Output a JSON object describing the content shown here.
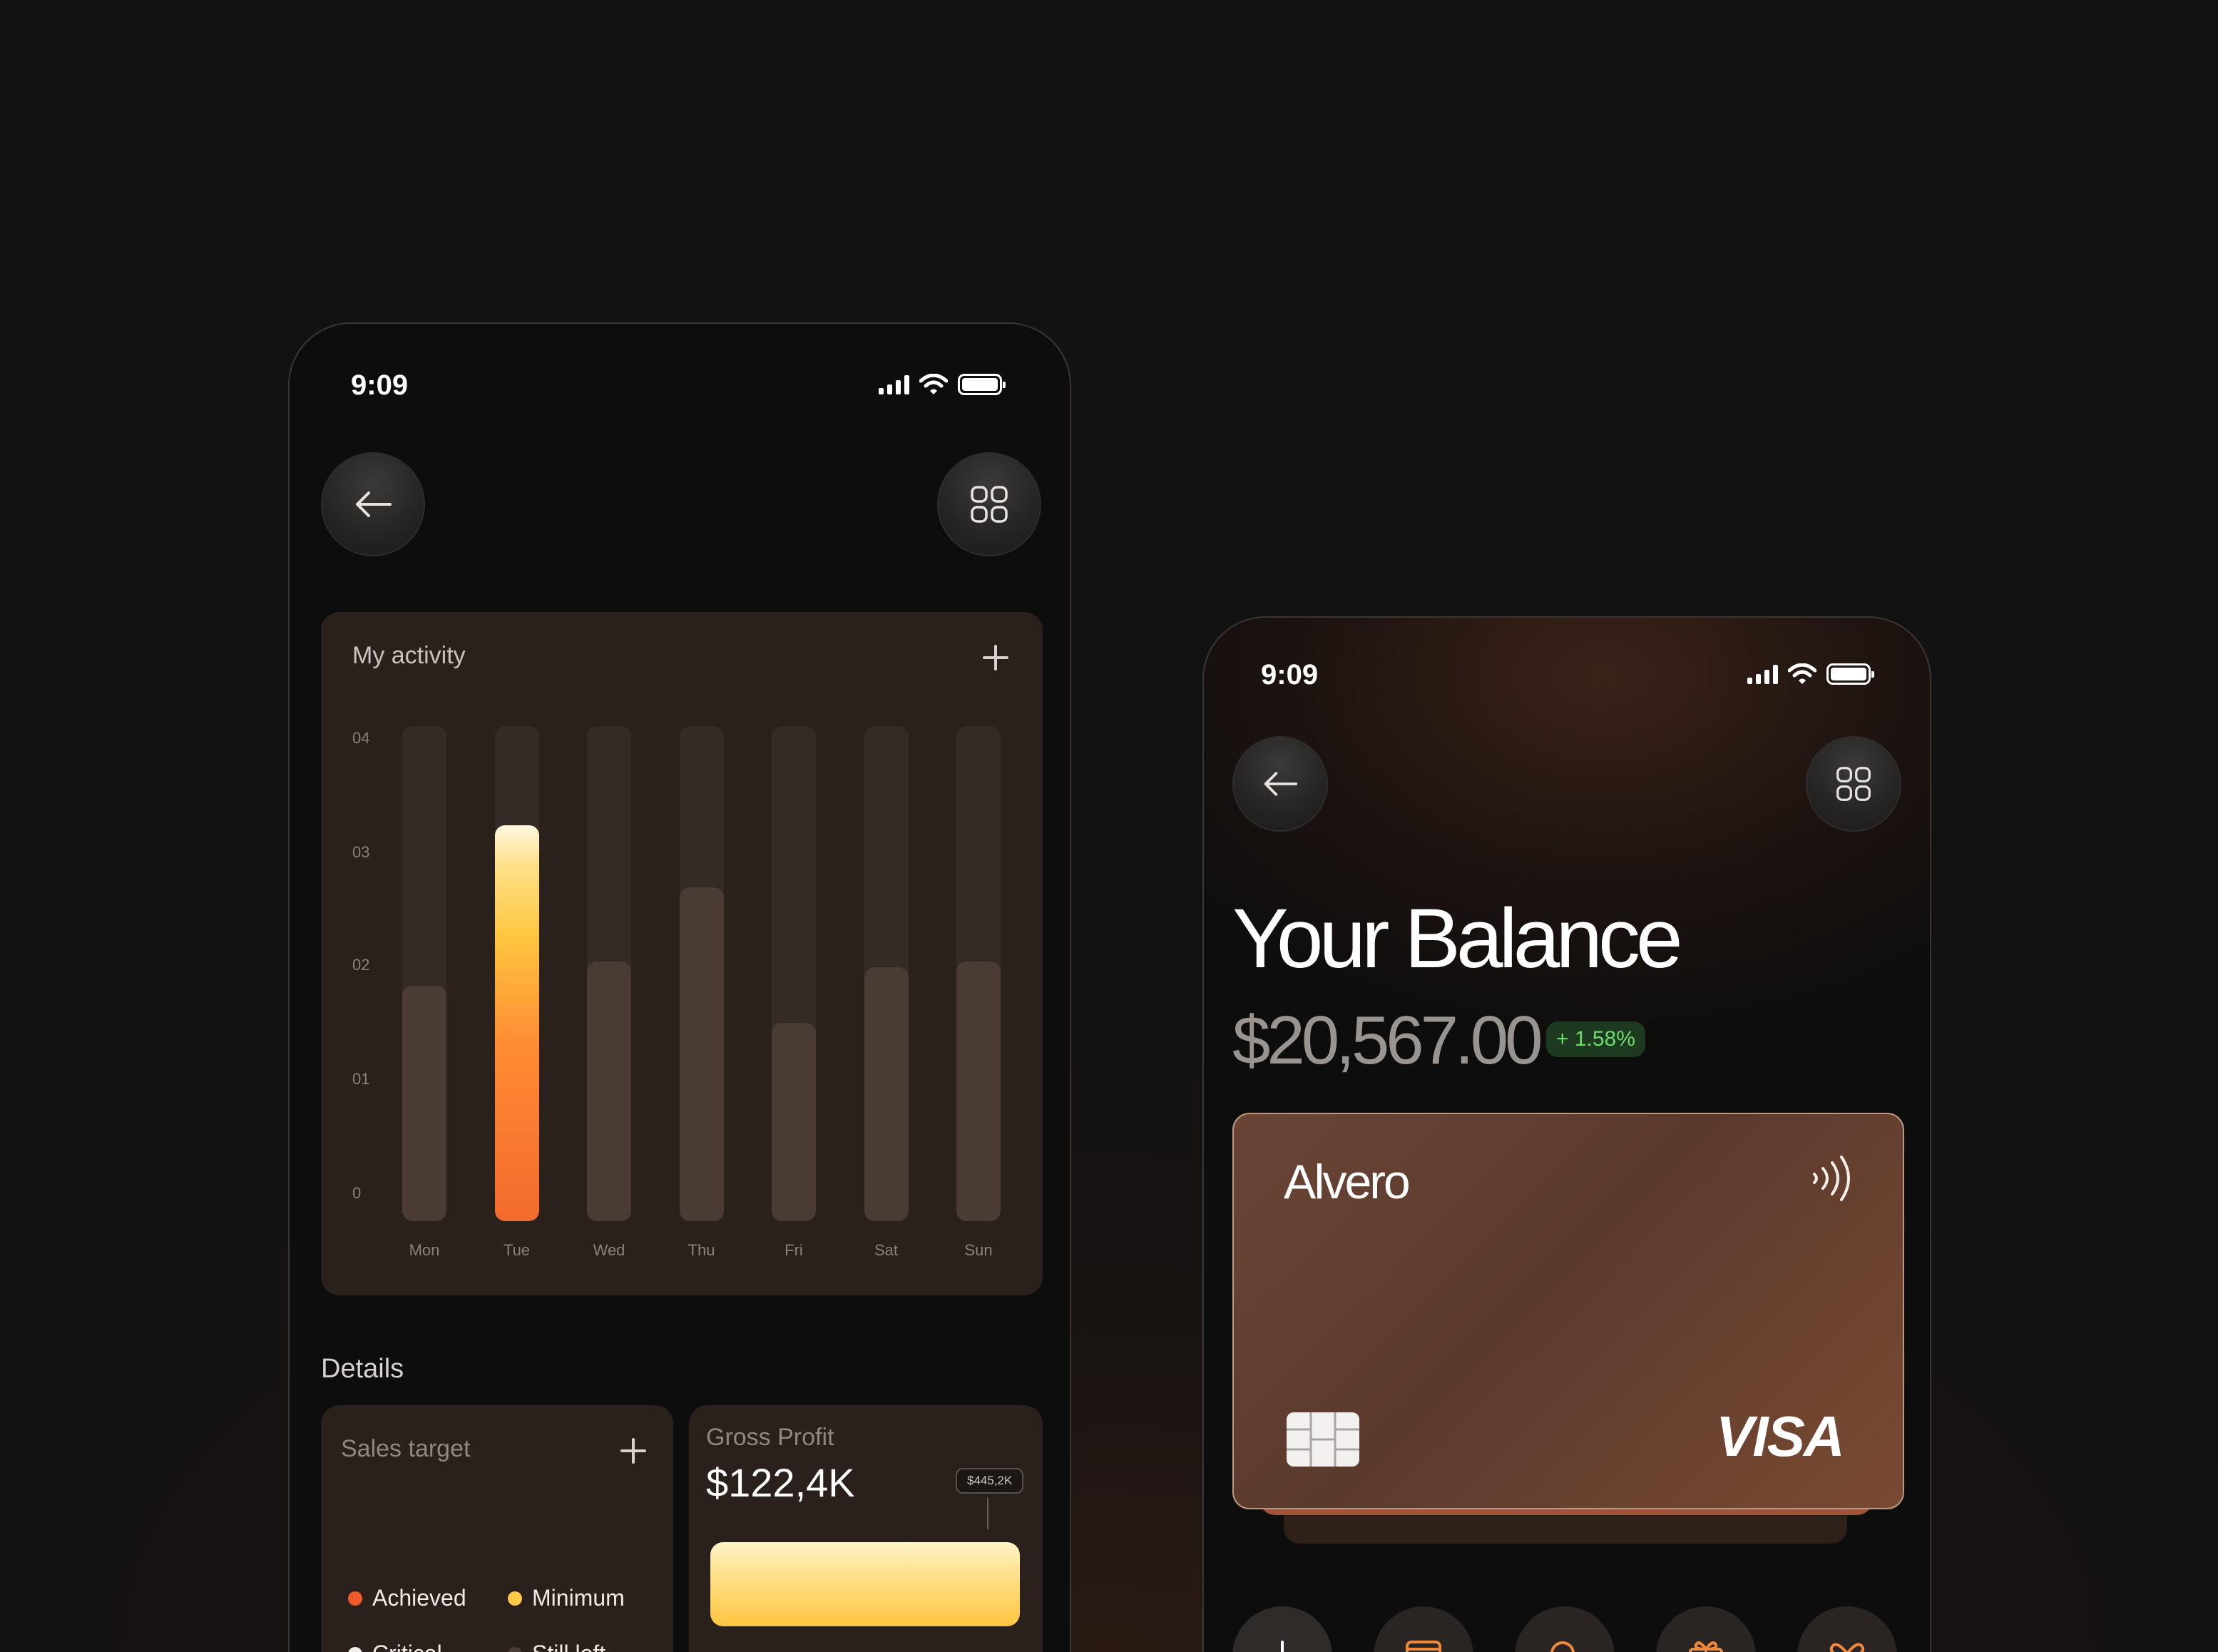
{
  "left_phone": {
    "status": {
      "time": "9:09"
    },
    "activity": {
      "title": "My activity",
      "y_ticks": [
        "04",
        "03",
        "02",
        "01",
        "0"
      ],
      "days": [
        {
          "label": "Mon",
          "value": 1.9
        },
        {
          "label": "Tue",
          "value": 3.2,
          "highlight": true
        },
        {
          "label": "Wed",
          "value": 2.1
        },
        {
          "label": "Thu",
          "value": 2.7
        },
        {
          "label": "Fri",
          "value": 1.6
        },
        {
          "label": "Sat",
          "value": 2.05
        },
        {
          "label": "Sun",
          "value": 2.1
        }
      ],
      "ylim": [
        0,
        4
      ]
    },
    "details": {
      "title": "Details",
      "sales_target": {
        "title": "Sales target",
        "legend": [
          {
            "label": "Achieved",
            "color": "#f0592a"
          },
          {
            "label": "Minimum",
            "color": "#ffc94a"
          },
          {
            "label": "Critical",
            "color": "#f1ede8"
          },
          {
            "label": "Still left",
            "color": "#4a3c35"
          }
        ]
      },
      "gross_profit": {
        "title": "Gross Profit",
        "value": "$122,4K",
        "tooltip": "$445,2K"
      }
    }
  },
  "right_phone": {
    "status": {
      "time": "9:09"
    },
    "balance": {
      "title": "Your Balance",
      "amount": "$20,567.00",
      "change": "+ 1.58%"
    },
    "card": {
      "brand": "Alvero",
      "network": "VISA"
    }
  },
  "colors": {
    "accent_orange": "#f26a2e",
    "accent_yellow": "#ffc640",
    "positive_green": "#6ddc6a"
  }
}
